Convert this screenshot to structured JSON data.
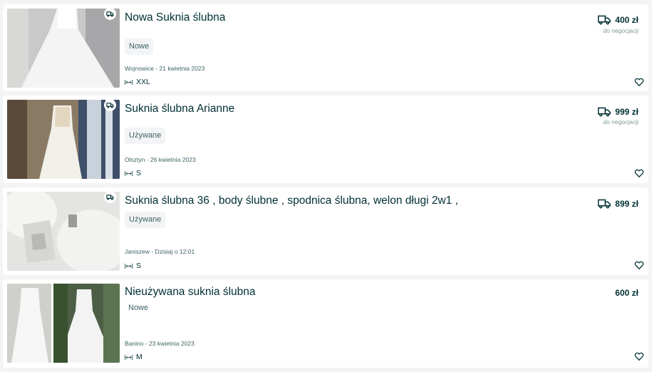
{
  "listings": [
    {
      "title": "Nowa Suknia ślubna",
      "condition": "Nowe",
      "location_date": "Wojnowice - 21 kwietnia 2023",
      "size": "XXL",
      "price": "400 zł",
      "negotiable": "do negocjacji",
      "delivery": true
    },
    {
      "title": "Suknia ślubna Arianne",
      "condition": "Używane",
      "location_date": "Olsztyn - 26 kwietnia 2023",
      "size": "S",
      "price": "999 zł",
      "negotiable": "do negocjacji",
      "delivery": true
    },
    {
      "title": "Suknia ślubna 36 , body ślubne , spodnica ślubna, welon długi 2w1 ,",
      "condition": "Używane",
      "location_date": "Janiszew - Dzisiaj o 12:01",
      "size": "S",
      "price": "899 zł",
      "delivery": true
    },
    {
      "title": "Nieużywana suknia ślubna",
      "condition": "Nowe",
      "location_date": "Banino - 23 kwietnia 2023",
      "size": "M",
      "price": "600 zł",
      "delivery": false
    }
  ],
  "icons": {
    "delivery": "truck-icon",
    "size": "size-arrows-icon",
    "favorite": "heart-outline-icon"
  },
  "colors": {
    "text": "#002f34",
    "muted": "#406367",
    "background": "#f2f4f5"
  }
}
